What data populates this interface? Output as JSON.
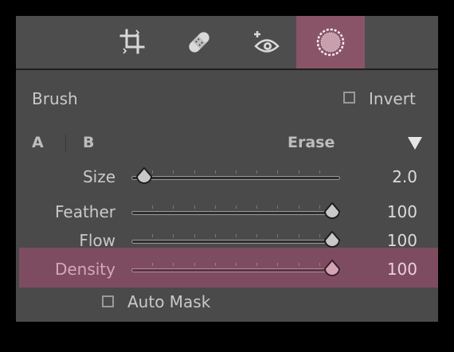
{
  "tools": [
    {
      "name": "crop",
      "icon": "crop-icon"
    },
    {
      "name": "healing",
      "icon": "bandage-icon"
    },
    {
      "name": "red-eye",
      "icon": "eye-plus-icon"
    },
    {
      "name": "brush-mask",
      "icon": "brush-circle-icon",
      "active": true
    }
  ],
  "brush": {
    "title": "Brush",
    "invert_label": "Invert",
    "invert_checked": false,
    "tab_a": "A",
    "tab_b": "B",
    "erase_label": "Erase"
  },
  "sliders": [
    {
      "label": "Size",
      "value": "2.0",
      "fraction": 0.06
    },
    {
      "label": "Feather",
      "value": "100",
      "fraction": 0.96
    },
    {
      "label": "Flow",
      "value": "100",
      "fraction": 0.96
    },
    {
      "label": "Density",
      "value": "100",
      "fraction": 0.96,
      "highlighted": true
    }
  ],
  "auto_mask": {
    "label": "Auto Mask",
    "checked": false
  },
  "colors": {
    "panel": "#4a4a4a",
    "accent": "#8a5468",
    "highlight": "#7e4c60"
  }
}
